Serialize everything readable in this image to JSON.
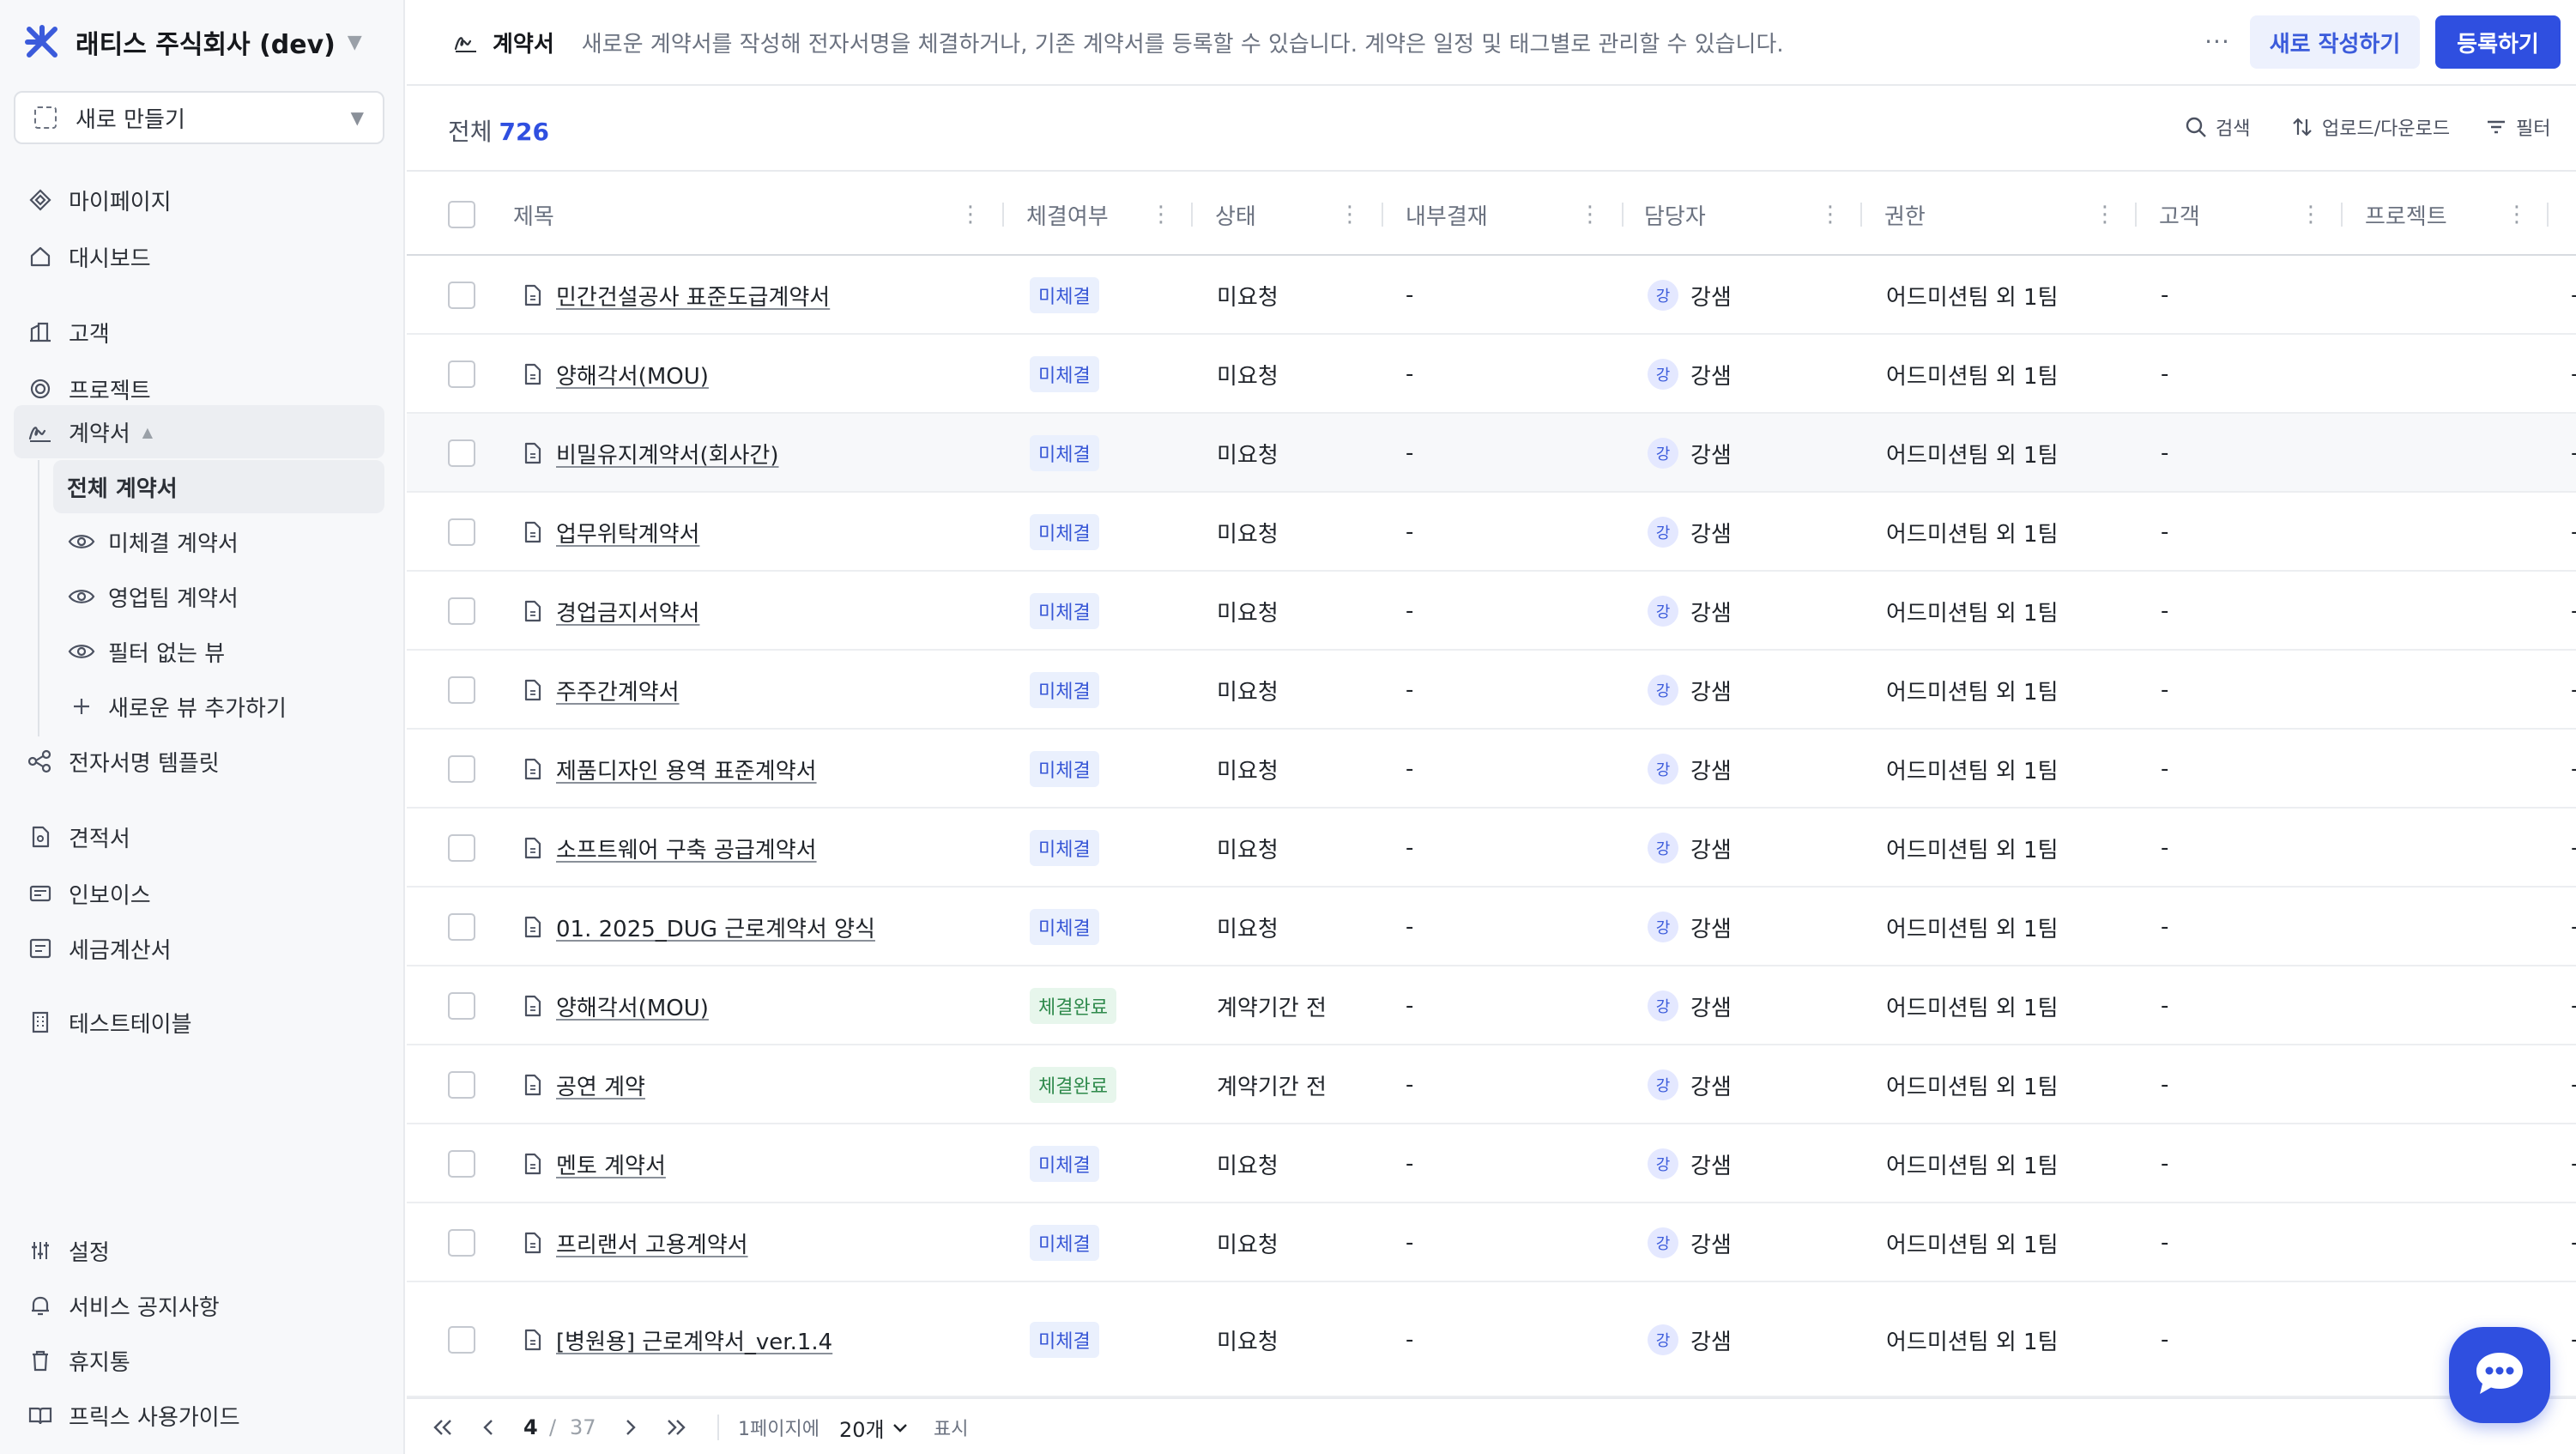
{
  "sidebar": {
    "org_name": "래티스 주식회사 (dev)",
    "new_button": "새로 만들기",
    "items": {
      "mypage": "마이페이지",
      "dashboard": "대시보드",
      "customers": "고객",
      "projects": "프로젝트",
      "contracts": "계약서",
      "esign_templates": "전자서명 템플릿",
      "quotes": "견적서",
      "invoices": "인보이스",
      "tax_invoices": "세금계산서",
      "test_table": "테스트테이블",
      "settings": "설정",
      "notices": "서비스 공지사항",
      "trash": "휴지통",
      "guide": "프릭스 사용가이드"
    },
    "contract_views": {
      "all": "전체 계약서",
      "unsigned": "미체결 계약서",
      "sales_team": "영업팀 계약서",
      "no_filter": "필터 없는 뷰",
      "add_view": "새로운 뷰 추가하기"
    }
  },
  "header": {
    "title": "계약서",
    "description": "새로운 계약서를 작성해 전자서명을 체결하거나, 기존 계약서를 등록할 수 있습니다. 계약은 일정 및 태그별로 관리할 수 있습니다.",
    "more": "···",
    "new_button": "새로 작성하기",
    "register_button": "등록하기"
  },
  "toolbar": {
    "total_label": "전체",
    "total_count": "726",
    "search": "검색",
    "upload_download": "업로드/다운로드",
    "filter": "필터"
  },
  "table": {
    "columns": {
      "title": "제목",
      "signed": "체결여부",
      "status": "상태",
      "approval": "내부결재",
      "owner": "담당자",
      "permission": "권한",
      "customer": "고객",
      "project": "프로젝트"
    },
    "rows": [
      {
        "title": "민간건설공사 표준도급계약서",
        "signed": "미체결",
        "status": "미요청",
        "approval": "-",
        "avatar": "강",
        "owner": "강샘",
        "permission": "어드미션팀 외 1팀",
        "customer": "-",
        "edge": "-"
      },
      {
        "title": "양해각서(MOU)",
        "signed": "미체결",
        "status": "미요청",
        "approval": "-",
        "avatar": "강",
        "owner": "강샘",
        "permission": "어드미션팀 외 1팀",
        "customer": "-",
        "edge": "-"
      },
      {
        "title": "비밀유지계약서(회사간)",
        "signed": "미체결",
        "status": "미요청",
        "approval": "-",
        "avatar": "강",
        "owner": "강샘",
        "permission": "어드미션팀 외 1팀",
        "customer": "-",
        "edge": "-"
      },
      {
        "title": "업무위탁계약서",
        "signed": "미체결",
        "status": "미요청",
        "approval": "-",
        "avatar": "강",
        "owner": "강샘",
        "permission": "어드미션팀 외 1팀",
        "customer": "-",
        "edge": "-"
      },
      {
        "title": "경업금지서약서",
        "signed": "미체결",
        "status": "미요청",
        "approval": "-",
        "avatar": "강",
        "owner": "강샘",
        "permission": "어드미션팀 외 1팀",
        "customer": "-",
        "edge": "-"
      },
      {
        "title": "주주간계약서",
        "signed": "미체결",
        "status": "미요청",
        "approval": "-",
        "avatar": "강",
        "owner": "강샘",
        "permission": "어드미션팀 외 1팀",
        "customer": "-",
        "edge": "-"
      },
      {
        "title": "제품디자인 용역 표준계약서",
        "signed": "미체결",
        "status": "미요청",
        "approval": "-",
        "avatar": "강",
        "owner": "강샘",
        "permission": "어드미션팀 외 1팀",
        "customer": "-",
        "edge": "-"
      },
      {
        "title": "소프트웨어 구축 공급계약서",
        "signed": "미체결",
        "status": "미요청",
        "approval": "-",
        "avatar": "강",
        "owner": "강샘",
        "permission": "어드미션팀 외 1팀",
        "customer": "-",
        "edge": "-"
      },
      {
        "title": "01. 2025_DUG 근로계약서 양식",
        "signed": "미체결",
        "status": "미요청",
        "approval": "-",
        "avatar": "강",
        "owner": "강샘",
        "permission": "어드미션팀 외 1팀",
        "customer": "-",
        "edge": "-"
      },
      {
        "title": "양해각서(MOU)",
        "signed": "체결완료",
        "status": "계약기간 전",
        "approval": "-",
        "avatar": "강",
        "owner": "강샘",
        "permission": "어드미션팀 외 1팀",
        "customer": "-",
        "edge": "-"
      },
      {
        "title": "공연 계약",
        "signed": "체결완료",
        "status": "계약기간 전",
        "approval": "-",
        "avatar": "강",
        "owner": "강샘",
        "permission": "어드미션팀 외 1팀",
        "customer": "-",
        "edge": "-"
      },
      {
        "title": "멘토 계약서",
        "signed": "미체결",
        "status": "미요청",
        "approval": "-",
        "avatar": "강",
        "owner": "강샘",
        "permission": "어드미션팀 외 1팀",
        "customer": "-",
        "edge": "-"
      },
      {
        "title": "프리랜서 고용계약서",
        "signed": "미체결",
        "status": "미요청",
        "approval": "-",
        "avatar": "강",
        "owner": "강샘",
        "permission": "어드미션팀 외 1팀",
        "customer": "-",
        "edge": "-"
      },
      {
        "title": "[병원용] 근로계약서_ver.1.4",
        "signed": "미체결",
        "status": "미요청",
        "approval": "-",
        "avatar": "강",
        "owner": "강샘",
        "permission": "어드미션팀 외 1팀",
        "customer": "-",
        "edge": "-"
      }
    ]
  },
  "pagination": {
    "current_page": "4",
    "separator": "/",
    "total_pages": "37",
    "per_page_label": "1페이지에",
    "per_page_value": "20개",
    "show_label": "표시"
  },
  "colors": {
    "accent": "#2f4fe0",
    "pending_badge_bg": "#eaf0fd",
    "done_badge_bg": "#e7f6ec"
  }
}
